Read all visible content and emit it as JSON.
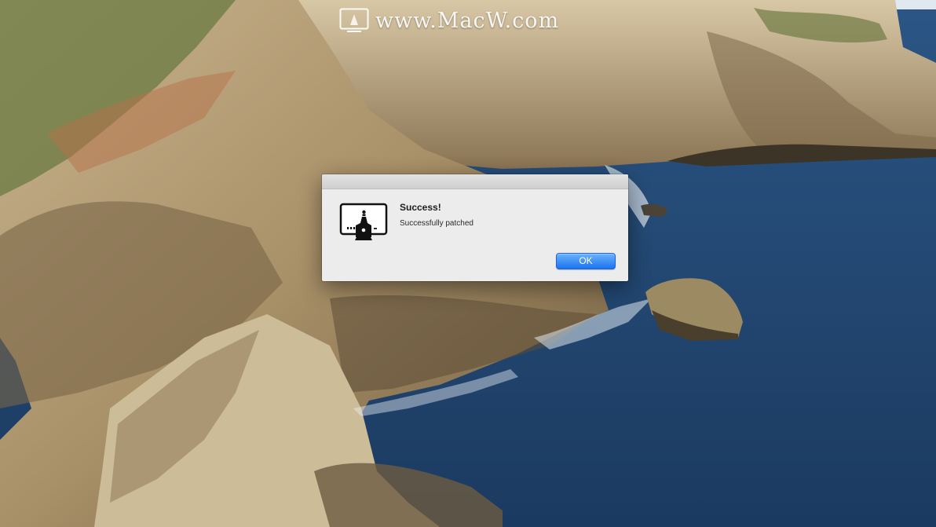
{
  "watermark": {
    "text": "www.MacW.com",
    "logo_icon": "macw-logo-icon"
  },
  "dialog": {
    "icon": "monitor-patch-app-icon",
    "title": "Success!",
    "message": "Successfully patched",
    "ok_label": "OK"
  },
  "colors": {
    "ocean": "#24456e",
    "rock": "#a6906a",
    "dialog_bg": "#ececec",
    "button_accent": "#1b73f0"
  }
}
